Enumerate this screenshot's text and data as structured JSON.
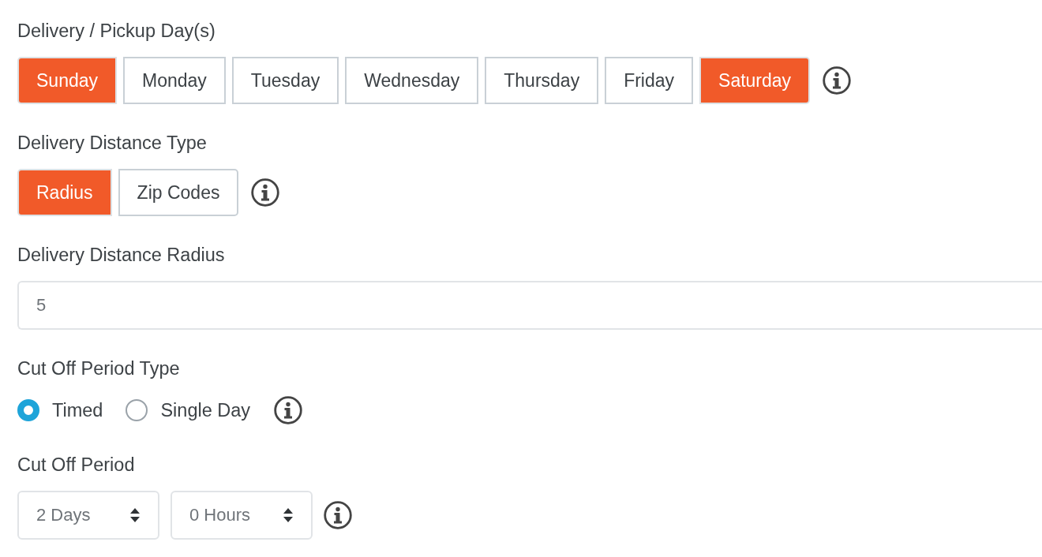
{
  "sections": [
    {
      "kind": "toggle_group",
      "label": "Delivery / Pickup Day(s)",
      "has_info": true,
      "options": [
        {
          "label": "Sunday",
          "selected": true
        },
        {
          "label": "Monday",
          "selected": false
        },
        {
          "label": "Tuesday",
          "selected": false
        },
        {
          "label": "Wednesday",
          "selected": false
        },
        {
          "label": "Thursday",
          "selected": false
        },
        {
          "label": "Friday",
          "selected": false
        },
        {
          "label": "Saturday",
          "selected": true
        }
      ]
    },
    {
      "kind": "toggle_group",
      "label": "Delivery Distance Type",
      "has_info": true,
      "options": [
        {
          "label": "Radius",
          "selected": true
        },
        {
          "label": "Zip Codes",
          "selected": false
        }
      ]
    },
    {
      "kind": "text_input",
      "label": "Delivery Distance Radius",
      "has_info": false,
      "value": "5"
    },
    {
      "kind": "radio_group",
      "label": "Cut Off Period Type",
      "has_info": true,
      "options": [
        {
          "label": "Timed",
          "selected": true
        },
        {
          "label": "Single Day",
          "selected": false
        }
      ]
    },
    {
      "kind": "selects",
      "label": "Cut Off Period",
      "has_info": true,
      "selects": [
        {
          "value": "2 Days"
        },
        {
          "value": "0 Hours"
        }
      ]
    }
  ]
}
